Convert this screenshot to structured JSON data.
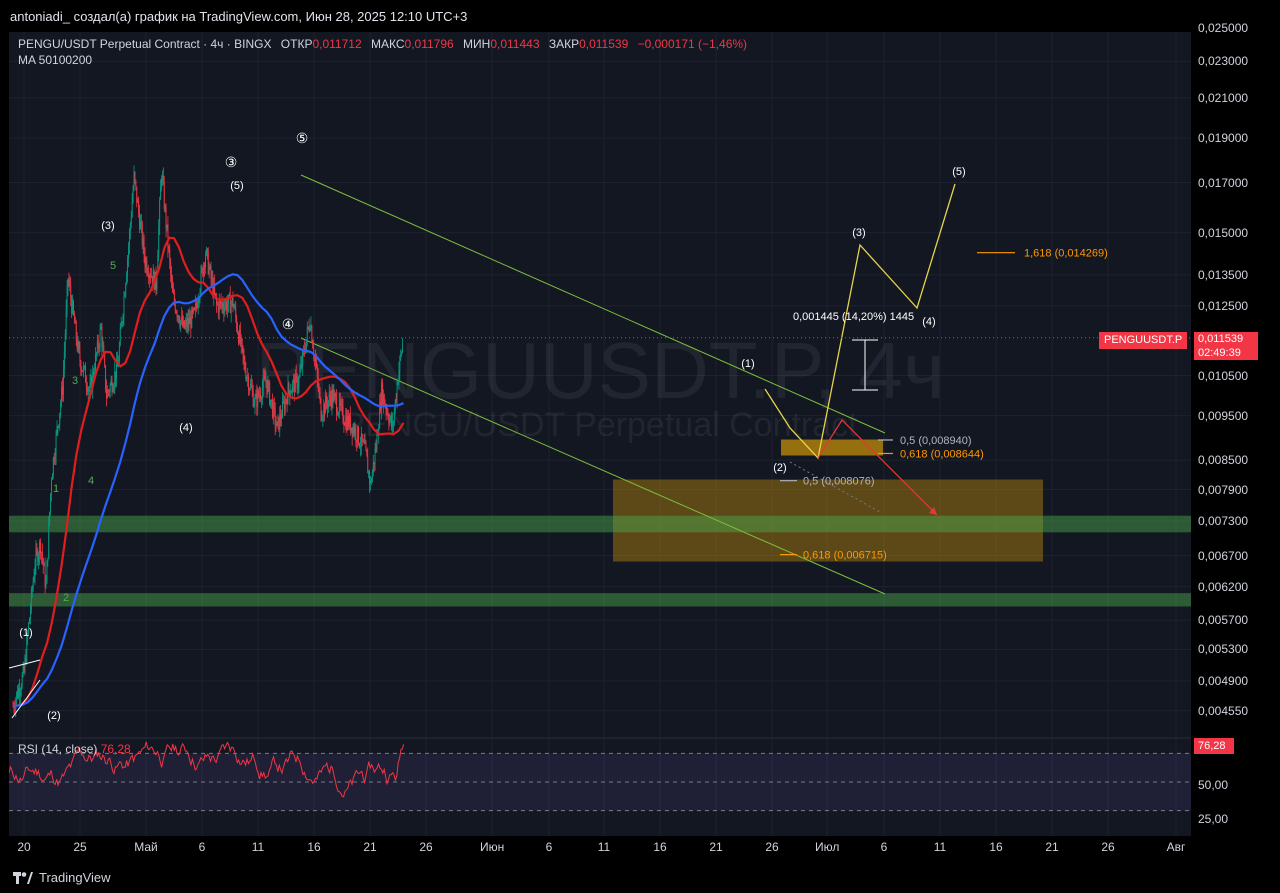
{
  "header": {
    "author_text": "antoniadi_ создал(а) график на TradingView.com, Июн 28, 2025 12:10 UTC+3"
  },
  "legend": {
    "symbol": "PENGU/USDT Perpetual Contract · 4ч · BINGX",
    "open_label": "ОТКР",
    "open_value": "0,011712",
    "high_label": "МАКС",
    "high_value": "0,011796",
    "low_label": "МИН",
    "low_value": "0,011443",
    "close_label": "ЗАКР",
    "close_value": "0,011539",
    "change": "−0,000171 (−1,46%)",
    "ma_line": "MA 50100200"
  },
  "watermark": {
    "big": "PENGUUSDT.P, 4ч",
    "small": "PENGU/USDT Perpetual Contract"
  },
  "price_tag": {
    "symbol": "PENGUUSDT.P",
    "price": "0,011539",
    "countdown": "02:49:39"
  },
  "rsi": {
    "label": "RSI (14, close)",
    "value": "76,28"
  },
  "brand": {
    "name": "TradingView"
  },
  "colors": {
    "background": "#131722",
    "up": "#089981",
    "down": "#f23645",
    "ma_red": "#e01e1e",
    "ma_blue": "#2962ff",
    "channel": "#7bbf3c",
    "zone_orange": "#b8860b",
    "zone_green": "#4caf50",
    "projection_yellow": "#e6d34a",
    "fib_orange": "#ff9800",
    "rsi_line": "#f23645",
    "rsi_band": "#7e57c2"
  },
  "chart_data": {
    "type": "candlestick",
    "title": "PENGU/USDT Perpetual Contract · 4ч · BINGX",
    "price_axis_labels": [
      "0,025000",
      "0,023000",
      "0,021000",
      "0,019000",
      "0,017000",
      "0,015000",
      "0,013500",
      "0,012500",
      "0,010500",
      "0,009500",
      "0,008500",
      "0,007900",
      "0,007300",
      "0,006700",
      "0,006200",
      "0,005700",
      "0,005300",
      "0,004900",
      "0,004550"
    ],
    "time_axis_labels": [
      "20",
      "25",
      "Май",
      "6",
      "11",
      "16",
      "21",
      "26",
      "Июн",
      "6",
      "11",
      "16",
      "21",
      "26",
      "Июл",
      "6",
      "11",
      "16",
      "21",
      "26",
      "Авг"
    ],
    "ylim": [
      0.0044,
      0.0255
    ],
    "log_scale": true,
    "close_path": [
      {
        "t": "Apr 18",
        "v": 0.0046
      },
      {
        "t": "Apr 20",
        "v": 0.005
      },
      {
        "t": "Apr 22",
        "v": 0.0066
      },
      {
        "t": "Apr 23",
        "v": 0.0069
      },
      {
        "t": "Apr 24",
        "v": 0.0062
      },
      {
        "t": "Apr 25",
        "v": 0.0082
      },
      {
        "t": "Apr 27",
        "v": 0.0102
      },
      {
        "t": "Apr 28",
        "v": 0.0134
      },
      {
        "t": "Apr 30",
        "v": 0.011
      },
      {
        "t": "May 2",
        "v": 0.0101
      },
      {
        "t": "May 4",
        "v": 0.0118
      },
      {
        "t": "May 5",
        "v": 0.01
      },
      {
        "t": "May 7",
        "v": 0.0107
      },
      {
        "t": "May 9",
        "v": 0.0145
      },
      {
        "t": "May 10",
        "v": 0.0172
      },
      {
        "t": "May 12",
        "v": 0.014
      },
      {
        "t": "May 14",
        "v": 0.0132
      },
      {
        "t": "May 15",
        "v": 0.0175
      },
      {
        "t": "May 17",
        "v": 0.0128
      },
      {
        "t": "May 19",
        "v": 0.0118
      },
      {
        "t": "May 21",
        "v": 0.0122
      },
      {
        "t": "May 23",
        "v": 0.0143
      },
      {
        "t": "May 25",
        "v": 0.0125
      },
      {
        "t": "May 28",
        "v": 0.0126
      },
      {
        "t": "May 30",
        "v": 0.0108
      },
      {
        "t": "Jun 1",
        "v": 0.0098
      },
      {
        "t": "Jun 3",
        "v": 0.0104
      },
      {
        "t": "Jun 5",
        "v": 0.0092
      },
      {
        "t": "Jun 7",
        "v": 0.0101
      },
      {
        "t": "Jun 9",
        "v": 0.0104
      },
      {
        "t": "Jun 11",
        "v": 0.0121
      },
      {
        "t": "Jun 13",
        "v": 0.0096
      },
      {
        "t": "Jun 15",
        "v": 0.01
      },
      {
        "t": "Jun 17",
        "v": 0.0095
      },
      {
        "t": "Jun 19",
        "v": 0.0092
      },
      {
        "t": "Jun 21",
        "v": 0.0087
      },
      {
        "t": "Jun 22",
        "v": 0.008
      },
      {
        "t": "Jun 23",
        "v": 0.0088
      },
      {
        "t": "Jun 24",
        "v": 0.0101
      },
      {
        "t": "Jun 26",
        "v": 0.0092
      },
      {
        "t": "Jun 27",
        "v": 0.0105
      },
      {
        "t": "Jun 28",
        "v": 0.011539
      }
    ],
    "series": [
      {
        "name": "MA 50",
        "color": "#e01e1e"
      },
      {
        "name": "MA 100",
        "color": "#2962ff"
      }
    ],
    "wave_labels": [
      "(1)",
      "(2)",
      "1",
      "2",
      "3",
      "4",
      "5",
      "(3)",
      "(4)",
      "(5)",
      "③",
      "④",
      "⑤",
      "(1)",
      "(2)",
      "(3)",
      "(4)",
      "(5)"
    ],
    "fib_levels": [
      {
        "label": "0,5 (0,008940)",
        "price": 0.00894
      },
      {
        "label": "0,618 (0,008644)",
        "price": 0.008644
      },
      {
        "label": "0,5 (0,008076)",
        "price": 0.008076
      },
      {
        "label": "0,618 (0,006715)",
        "price": 0.006715
      },
      {
        "label": "1,618 (0,014269)",
        "price": 0.014269
      }
    ],
    "measure": {
      "label": "0,001445 (14,20%) 1445"
    },
    "zones": [
      {
        "name": "orange-box",
        "from": 0.0066,
        "to": 0.0081
      },
      {
        "name": "green-zone-upper",
        "from": 0.0071,
        "to": 0.0074
      },
      {
        "name": "green-zone-lower",
        "from": 0.0059,
        "to": 0.0061
      }
    ],
    "rsi": {
      "levels": [
        70,
        50,
        30
      ],
      "axis_labels": [
        "50,00",
        "25,00"
      ],
      "last": 76.28
    }
  }
}
